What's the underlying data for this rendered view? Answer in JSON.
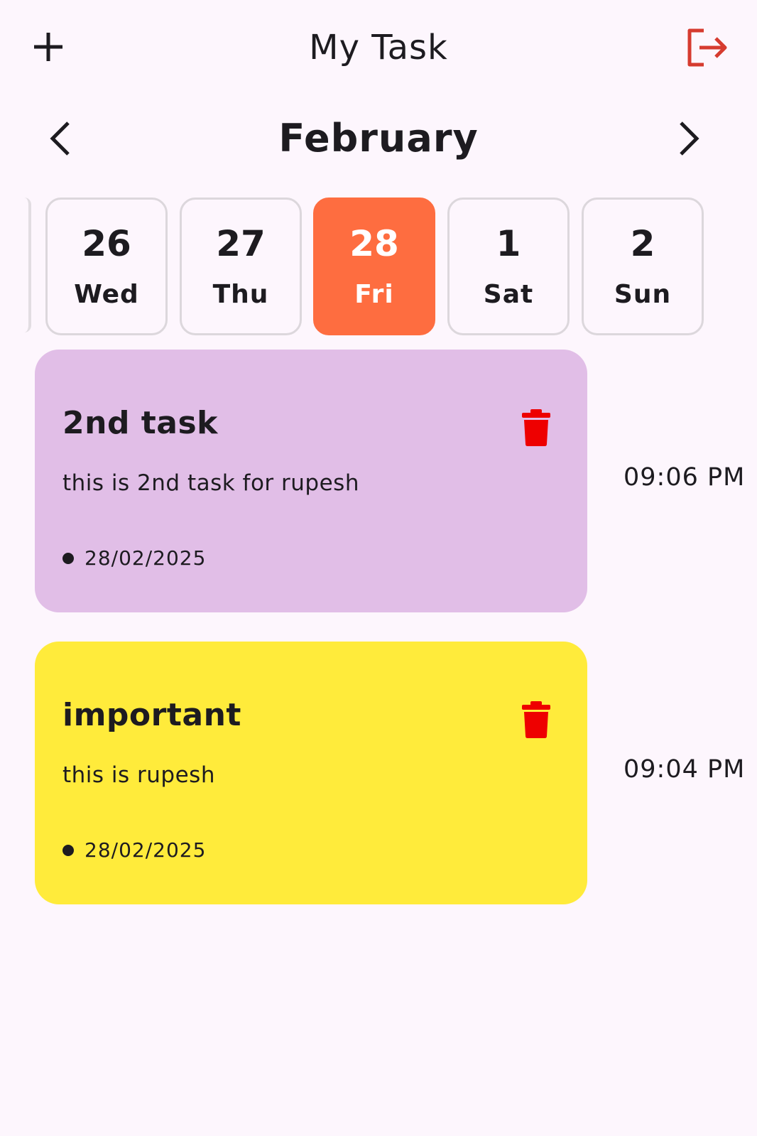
{
  "header": {
    "title": "My Task",
    "add_icon": "plus-icon",
    "logout_icon": "logout-icon",
    "logout_color": "#d63b2f"
  },
  "calendar": {
    "month": "February",
    "prev_icon": "chevron-left-icon",
    "next_icon": "chevron-right-icon",
    "selected_color": "#fe6d40",
    "dates": [
      {
        "num": "26",
        "day": "Wed",
        "selected": false
      },
      {
        "num": "27",
        "day": "Thu",
        "selected": false
      },
      {
        "num": "28",
        "day": "Fri",
        "selected": true
      },
      {
        "num": "1",
        "day": "Sat",
        "selected": false
      },
      {
        "num": "2",
        "day": "Sun",
        "selected": false
      }
    ]
  },
  "tasks": [
    {
      "title": "2nd task",
      "description": "this is 2nd task for rupesh",
      "date": "28/02/2025",
      "time": "09:06 PM",
      "color": "#e1bee7",
      "delete_icon": "trash-icon"
    },
    {
      "title": "important",
      "description": "this is rupesh",
      "date": "28/02/2025",
      "time": "09:04 PM",
      "color": "#ffeb3b",
      "delete_icon": "trash-icon"
    }
  ],
  "colors": {
    "background": "#fdf6fd",
    "text": "#1d1b20",
    "delete_icon": "#ee0000"
  }
}
